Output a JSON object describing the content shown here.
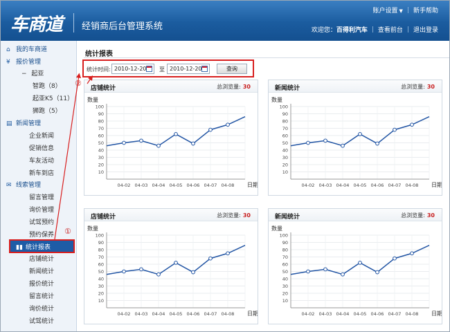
{
  "header": {
    "logo": "车商道",
    "system_title": "经销商后台管理系统",
    "top_links": [
      "账户设置",
      "新手帮助"
    ],
    "welcome": "欢迎您：",
    "username": "百得利汽车",
    "user_links": [
      "查看前台",
      "退出登录"
    ]
  },
  "sidebar": {
    "sections": [
      {
        "label": "我的车商道",
        "icon": "home-icon"
      },
      {
        "label": "报价管理",
        "icon": "yen-icon"
      },
      {
        "label": "新闻管理",
        "icon": "news-icon"
      },
      {
        "label": "线索管理",
        "icon": "chat-icon"
      }
    ],
    "price_tree": {
      "toggle": "−",
      "brand": "起亚",
      "models": [
        "智跑（8）",
        "起亚K5（11）",
        "狮跑（5）"
      ]
    },
    "news_items": [
      "企业新闻",
      "促销信息",
      "车友活动",
      "新车到店"
    ],
    "lead_items": [
      "留言管理",
      "询价管理",
      "试驾预约",
      "预约保养"
    ],
    "active": {
      "label": "统计报表",
      "icon": "bar-chart-icon"
    },
    "stat_items": [
      "店铺统计",
      "新闻统计",
      "报价统计",
      "留言统计",
      "询价统计",
      "试驾统计"
    ]
  },
  "main": {
    "title": "统计报表",
    "filter": {
      "label": "统计时间:",
      "from": "2010-12-20",
      "to_text": "至",
      "to": "2010-12-20",
      "button": "查询"
    },
    "markers": {
      "one": "①",
      "two": "②"
    },
    "panels": [
      {
        "title": "店铺统计",
        "total_label": "总浏览量:",
        "total": "30"
      },
      {
        "title": "新闻统计",
        "total_label": "总浏览量:",
        "total": "30"
      },
      {
        "title": "店铺统计",
        "total_label": "总浏览量:",
        "total": "30"
      },
      {
        "title": "新闻统计",
        "total_label": "总浏览量:",
        "total": "30"
      }
    ]
  },
  "colors": {
    "header": "#1b5c9f",
    "line": "#2255a4",
    "highlight": "#d81e1e",
    "total": "#c81e1e"
  },
  "chart_data": [
    {
      "type": "line",
      "ylabel": "数量",
      "xlabel": "日期",
      "ylim": [
        0,
        100
      ],
      "yticks": [
        10,
        20,
        30,
        40,
        50,
        60,
        70,
        80,
        90,
        100
      ],
      "x": [
        "04-02",
        "04-03",
        "04-04",
        "04-05",
        "04-06",
        "04-07",
        "04-08"
      ],
      "y": [
        46,
        50,
        53,
        46,
        62,
        49,
        68,
        75,
        86
      ]
    },
    {
      "type": "line",
      "ylabel": "数量",
      "xlabel": "日期",
      "ylim": [
        0,
        100
      ],
      "yticks": [
        10,
        20,
        30,
        40,
        50,
        60,
        70,
        80,
        90,
        100
      ],
      "x": [
        "04-02",
        "04-03",
        "04-04",
        "04-05",
        "04-06",
        "04-07",
        "04-08"
      ],
      "y": [
        46,
        50,
        53,
        46,
        62,
        49,
        68,
        75,
        86
      ]
    },
    {
      "type": "line",
      "ylabel": "数量",
      "xlabel": "日期",
      "ylim": [
        0,
        100
      ],
      "yticks": [
        10,
        20,
        30,
        40,
        50,
        60,
        70,
        80,
        90,
        100
      ],
      "x": [
        "04-02",
        "04-03",
        "04-04",
        "04-05",
        "04-06",
        "04-07",
        "04-08"
      ],
      "y": [
        46,
        50,
        53,
        46,
        62,
        49,
        68,
        75,
        86
      ]
    },
    {
      "type": "line",
      "ylabel": "数量",
      "xlabel": "日期",
      "ylim": [
        0,
        100
      ],
      "yticks": [
        10,
        20,
        30,
        40,
        50,
        60,
        70,
        80,
        90,
        100
      ],
      "x": [
        "04-02",
        "04-03",
        "04-04",
        "04-05",
        "04-06",
        "04-07",
        "04-08"
      ],
      "y": [
        46,
        50,
        53,
        46,
        62,
        49,
        68,
        75,
        86
      ]
    }
  ]
}
